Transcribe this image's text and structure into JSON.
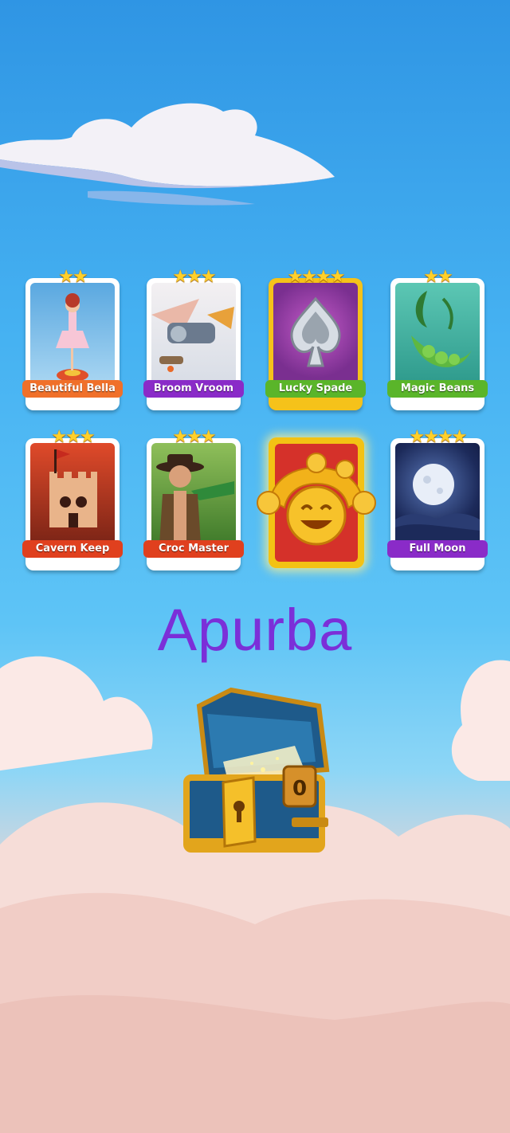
{
  "player_name": "Apurba",
  "cards": [
    {
      "label": "Beautiful Bella",
      "stars": "★★",
      "label_color": "#f0702a",
      "bg": "#6fb6e6"
    },
    {
      "label": "Broom Vroom",
      "stars": "★★★",
      "label_color": "#8a2bc8",
      "bg": "#e8e8ee"
    },
    {
      "label": "Lucky Spade",
      "stars": "★★★★",
      "label_color": "#5ab52a",
      "bg": "#8a3fa8"
    },
    {
      "label": "Magic Beans",
      "stars": "★★",
      "label_color": "#5ab52a",
      "bg": "#3fb3a0"
    },
    {
      "label": "Cavern Keep",
      "stars": "★★★",
      "label_color": "#e0401e",
      "bg": "#c0482a"
    },
    {
      "label": "Croc Master",
      "stars": "★★★",
      "label_color": "#e0401e",
      "bg": "#6a9a40"
    },
    {
      "label": "Full Moon",
      "stars": "★★★★",
      "label_color": "#8a2bc8",
      "bg": "#1c2a5a"
    }
  ],
  "icons": {
    "jester": "jester-face-icon",
    "chest": "treasure-chest-icon",
    "cloud": "cloud-icon"
  }
}
